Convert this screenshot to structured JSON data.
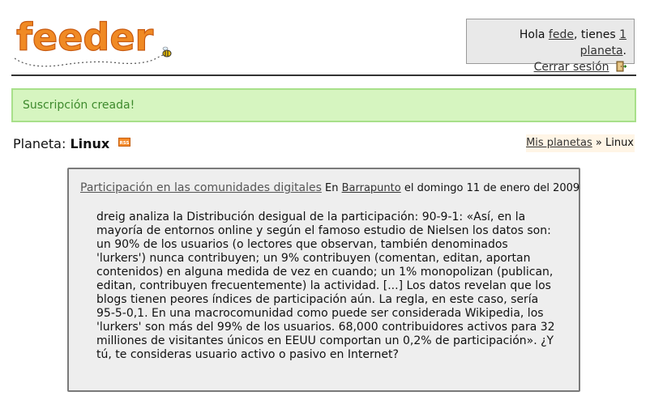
{
  "header": {
    "logo_text": "feeder",
    "greeting_prefix": "Hola ",
    "username": "fede",
    "greeting_middle": ", tienes ",
    "planets_link": "1 planeta",
    "greeting_suffix": ".",
    "logout_label": "Cerrar sesión"
  },
  "flash": {
    "message": "Suscripción creada!"
  },
  "planet": {
    "label": "Planeta:",
    "name": "Linux",
    "rss_icon_text": "RSS"
  },
  "breadcrumb": {
    "parent_link": "Mis planetas",
    "separator": "»",
    "current": "Linux"
  },
  "post": {
    "title": "Participación en las comunidades digitales",
    "source_prefix": "En",
    "source": "Barrapunto",
    "date": "el domingo 11 de enero del 2009",
    "body": "dreig analiza la Distribución desigual de la participación: 90-9-1: «Así, en la mayoría de entornos online y según el famoso estudio de Nielsen los datos son: un 90% de los usuarios (o lectores que observan, también denominados 'lurkers') nunca contribuyen; un 9% contribuyen (comentan, editan, aportan contenidos) en alguna medida de vez en cuando; un 1% monopolizan (publican, editan, contribuyen frecuentemente) la actividad. [...] Los datos revelan que los blogs tienen peores índices de participación aún. La regla, en este caso, sería 95-5-0,1. En una macrocomunidad como puede ser considerada Wikipedia, los 'lurkers' son más del 99% de los usuarios. 68,000 contribuidores activos para 32 milliones de visitantes únicos en EEUU comportan un 0,2% de participación». ¿Y tú, te consideras usuario activo o pasivo en Internet?"
  },
  "colors": {
    "logo_orange": "#f08a24",
    "flash_background": "#d6f5c0",
    "flash_text": "#3d8a2c",
    "user_box_background": "#e9e9e9",
    "post_background": "#eeeeee"
  }
}
